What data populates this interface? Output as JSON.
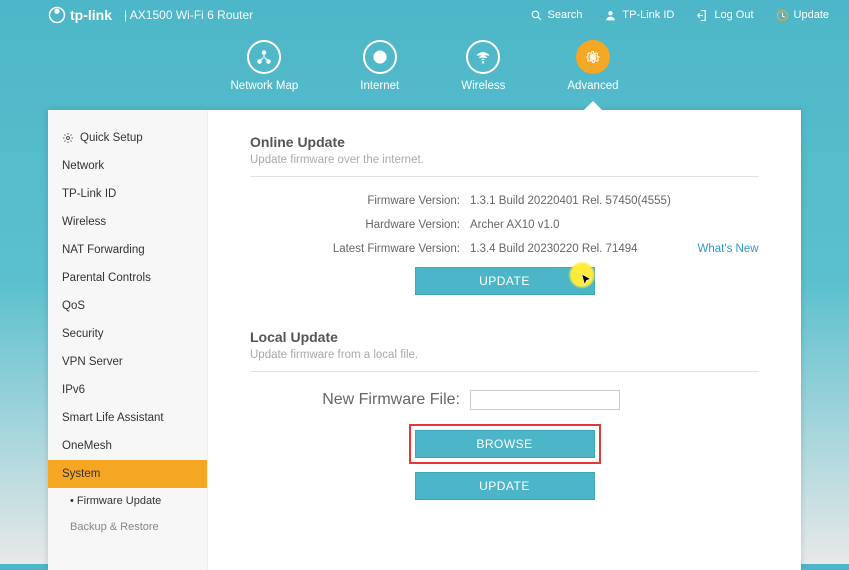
{
  "brand": "tp-link",
  "product": "AX1500 Wi-Fi 6 Router",
  "topActions": {
    "search": "Search",
    "tplinkid": "TP-Link ID",
    "logout": "Log Out",
    "update": "Update"
  },
  "tabs": {
    "networkMap": "Network Map",
    "internet": "Internet",
    "wireless": "Wireless",
    "advanced": "Advanced"
  },
  "sidebar": {
    "quickSetup": "Quick Setup",
    "items": [
      "Network",
      "TP-Link ID",
      "Wireless",
      "NAT Forwarding",
      "Parental Controls",
      "QoS",
      "Security",
      "VPN Server",
      "IPv6",
      "Smart Life Assistant",
      "OneMesh",
      "System"
    ],
    "subs": {
      "firmwareUpdate": "Firmware Update",
      "backupRestore": "Backup & Restore"
    }
  },
  "online": {
    "title": "Online Update",
    "desc": "Update firmware over the internet.",
    "fwLabel": "Firmware Version:",
    "fwValue": "1.3.1 Build 20220401 Rel. 57450(4555)",
    "hwLabel": "Hardware Version:",
    "hwValue": "Archer AX10 v1.0",
    "latestLabel": "Latest Firmware Version:",
    "latestValue": "1.3.4 Build 20230220 Rel. 71494",
    "whatsNew": "What's New",
    "updateBtn": "UPDATE"
  },
  "local": {
    "title": "Local Update",
    "desc": "Update firmware from a local file.",
    "fileLabel": "New Firmware File:",
    "browseBtn": "BROWSE",
    "updateBtn": "UPDATE"
  }
}
